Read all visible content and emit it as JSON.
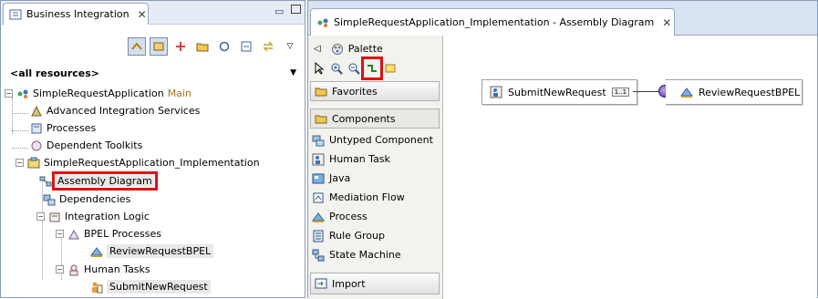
{
  "left_view": {
    "tab_title": "Business Integration",
    "filter_label": "<all resources>",
    "tree": {
      "root": {
        "label": "SimpleRequestApplication",
        "suffix": "Main"
      },
      "items": [
        "Advanced Integration Services",
        "Processes",
        "Dependent Toolkits",
        "SimpleRequestApplication_Implementation",
        "Assembly Diagram",
        "Dependencies",
        "Integration Logic",
        "BPEL Processes",
        "ReviewRequestBPEL",
        "Human Tasks",
        "SubmitNewRequest"
      ]
    }
  },
  "editor": {
    "tab_title": "SimpleRequestApplication_Implementation - Assembly Diagram",
    "palette": {
      "title": "Palette",
      "favorites": "Favorites",
      "components": "Components",
      "items": [
        "Untyped Component",
        "Human Task",
        "Java",
        "Mediation Flow",
        "Process",
        "Rule Group",
        "State Machine"
      ],
      "import": "Import"
    },
    "canvas": {
      "nodes": [
        {
          "label": "SubmitNewRequest",
          "badge": "1..1"
        },
        {
          "label": "ReviewRequestBPEL"
        }
      ]
    }
  },
  "colors": {
    "highlight": "#e01010",
    "tab_bg": "#d8e2f2",
    "selection": "#e8e8e8"
  }
}
